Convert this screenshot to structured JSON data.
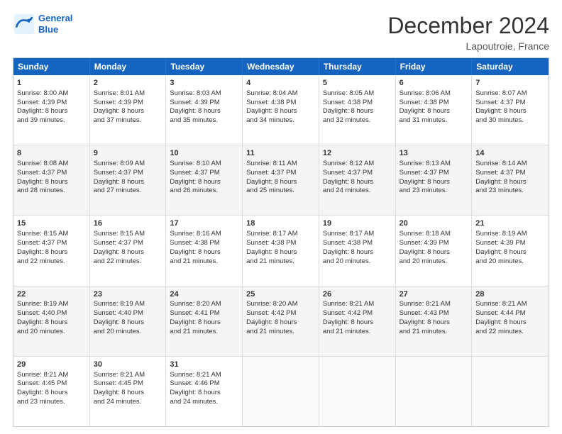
{
  "logo": {
    "line1": "General",
    "line2": "Blue"
  },
  "title": "December 2024",
  "location": "Lapoutroie, France",
  "headers": [
    "Sunday",
    "Monday",
    "Tuesday",
    "Wednesday",
    "Thursday",
    "Friday",
    "Saturday"
  ],
  "rows": [
    [
      {
        "day": "1",
        "lines": [
          "Sunrise: 8:00 AM",
          "Sunset: 4:39 PM",
          "Daylight: 8 hours",
          "and 39 minutes."
        ]
      },
      {
        "day": "2",
        "lines": [
          "Sunrise: 8:01 AM",
          "Sunset: 4:39 PM",
          "Daylight: 8 hours",
          "and 37 minutes."
        ]
      },
      {
        "day": "3",
        "lines": [
          "Sunrise: 8:03 AM",
          "Sunset: 4:39 PM",
          "Daylight: 8 hours",
          "and 35 minutes."
        ]
      },
      {
        "day": "4",
        "lines": [
          "Sunrise: 8:04 AM",
          "Sunset: 4:38 PM",
          "Daylight: 8 hours",
          "and 34 minutes."
        ]
      },
      {
        "day": "5",
        "lines": [
          "Sunrise: 8:05 AM",
          "Sunset: 4:38 PM",
          "Daylight: 8 hours",
          "and 32 minutes."
        ]
      },
      {
        "day": "6",
        "lines": [
          "Sunrise: 8:06 AM",
          "Sunset: 4:38 PM",
          "Daylight: 8 hours",
          "and 31 minutes."
        ]
      },
      {
        "day": "7",
        "lines": [
          "Sunrise: 8:07 AM",
          "Sunset: 4:37 PM",
          "Daylight: 8 hours",
          "and 30 minutes."
        ]
      }
    ],
    [
      {
        "day": "8",
        "lines": [
          "Sunrise: 8:08 AM",
          "Sunset: 4:37 PM",
          "Daylight: 8 hours",
          "and 28 minutes."
        ]
      },
      {
        "day": "9",
        "lines": [
          "Sunrise: 8:09 AM",
          "Sunset: 4:37 PM",
          "Daylight: 8 hours",
          "and 27 minutes."
        ]
      },
      {
        "day": "10",
        "lines": [
          "Sunrise: 8:10 AM",
          "Sunset: 4:37 PM",
          "Daylight: 8 hours",
          "and 26 minutes."
        ]
      },
      {
        "day": "11",
        "lines": [
          "Sunrise: 8:11 AM",
          "Sunset: 4:37 PM",
          "Daylight: 8 hours",
          "and 25 minutes."
        ]
      },
      {
        "day": "12",
        "lines": [
          "Sunrise: 8:12 AM",
          "Sunset: 4:37 PM",
          "Daylight: 8 hours",
          "and 24 minutes."
        ]
      },
      {
        "day": "13",
        "lines": [
          "Sunrise: 8:13 AM",
          "Sunset: 4:37 PM",
          "Daylight: 8 hours",
          "and 23 minutes."
        ]
      },
      {
        "day": "14",
        "lines": [
          "Sunrise: 8:14 AM",
          "Sunset: 4:37 PM",
          "Daylight: 8 hours",
          "and 23 minutes."
        ]
      }
    ],
    [
      {
        "day": "15",
        "lines": [
          "Sunrise: 8:15 AM",
          "Sunset: 4:37 PM",
          "Daylight: 8 hours",
          "and 22 minutes."
        ]
      },
      {
        "day": "16",
        "lines": [
          "Sunrise: 8:15 AM",
          "Sunset: 4:37 PM",
          "Daylight: 8 hours",
          "and 22 minutes."
        ]
      },
      {
        "day": "17",
        "lines": [
          "Sunrise: 8:16 AM",
          "Sunset: 4:38 PM",
          "Daylight: 8 hours",
          "and 21 minutes."
        ]
      },
      {
        "day": "18",
        "lines": [
          "Sunrise: 8:17 AM",
          "Sunset: 4:38 PM",
          "Daylight: 8 hours",
          "and 21 minutes."
        ]
      },
      {
        "day": "19",
        "lines": [
          "Sunrise: 8:17 AM",
          "Sunset: 4:38 PM",
          "Daylight: 8 hours",
          "and 20 minutes."
        ]
      },
      {
        "day": "20",
        "lines": [
          "Sunrise: 8:18 AM",
          "Sunset: 4:39 PM",
          "Daylight: 8 hours",
          "and 20 minutes."
        ]
      },
      {
        "day": "21",
        "lines": [
          "Sunrise: 8:19 AM",
          "Sunset: 4:39 PM",
          "Daylight: 8 hours",
          "and 20 minutes."
        ]
      }
    ],
    [
      {
        "day": "22",
        "lines": [
          "Sunrise: 8:19 AM",
          "Sunset: 4:40 PM",
          "Daylight: 8 hours",
          "and 20 minutes."
        ]
      },
      {
        "day": "23",
        "lines": [
          "Sunrise: 8:19 AM",
          "Sunset: 4:40 PM",
          "Daylight: 8 hours",
          "and 20 minutes."
        ]
      },
      {
        "day": "24",
        "lines": [
          "Sunrise: 8:20 AM",
          "Sunset: 4:41 PM",
          "Daylight: 8 hours",
          "and 21 minutes."
        ]
      },
      {
        "day": "25",
        "lines": [
          "Sunrise: 8:20 AM",
          "Sunset: 4:42 PM",
          "Daylight: 8 hours",
          "and 21 minutes."
        ]
      },
      {
        "day": "26",
        "lines": [
          "Sunrise: 8:21 AM",
          "Sunset: 4:42 PM",
          "Daylight: 8 hours",
          "and 21 minutes."
        ]
      },
      {
        "day": "27",
        "lines": [
          "Sunrise: 8:21 AM",
          "Sunset: 4:43 PM",
          "Daylight: 8 hours",
          "and 21 minutes."
        ]
      },
      {
        "day": "28",
        "lines": [
          "Sunrise: 8:21 AM",
          "Sunset: 4:44 PM",
          "Daylight: 8 hours",
          "and 22 minutes."
        ]
      }
    ],
    [
      {
        "day": "29",
        "lines": [
          "Sunrise: 8:21 AM",
          "Sunset: 4:45 PM",
          "Daylight: 8 hours",
          "and 23 minutes."
        ]
      },
      {
        "day": "30",
        "lines": [
          "Sunrise: 8:21 AM",
          "Sunset: 4:45 PM",
          "Daylight: 8 hours",
          "and 24 minutes."
        ]
      },
      {
        "day": "31",
        "lines": [
          "Sunrise: 8:21 AM",
          "Sunset: 4:46 PM",
          "Daylight: 8 hours",
          "and 24 minutes."
        ]
      },
      null,
      null,
      null,
      null
    ]
  ]
}
